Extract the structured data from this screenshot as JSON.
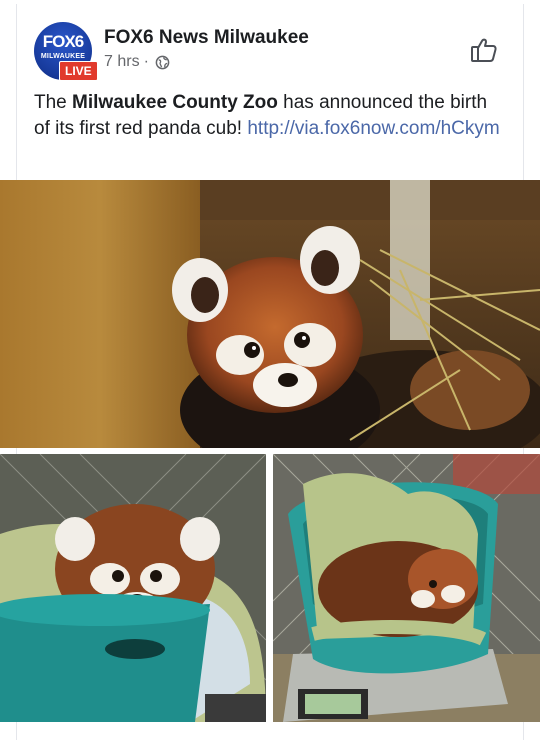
{
  "post": {
    "avatar": {
      "logo_text": "FOX6",
      "subtitle": "MILWAUKEE",
      "badge": "LIVE"
    },
    "page_name": "FOX6 News Milwaukee",
    "time": "7 hrs",
    "separator": "·",
    "privacy_icon": "globe-icon",
    "like_icon": "thumbs-up-icon",
    "text": {
      "prefix": "The ",
      "bold": "Milwaukee County Zoo",
      "middle": " has announced the birth of its first red panda cub! ",
      "link": "http://via.fox6now.com/hCkym"
    },
    "link_color": "#4b68a8"
  },
  "photos": [
    {
      "label": "red panda cub in wooden crate with hay"
    },
    {
      "label": "red panda cub in teal basket on towel"
    },
    {
      "label": "red panda cub curled in teal basket on scale"
    }
  ]
}
